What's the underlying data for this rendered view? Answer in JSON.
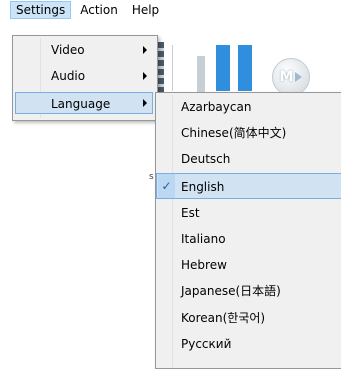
{
  "menubar": {
    "settings": "Settings",
    "action": "Action",
    "help": "Help"
  },
  "toolbar": {
    "m_button": "M"
  },
  "stray_text": "s",
  "settings_menu": {
    "items": [
      {
        "label": "Video",
        "has_submenu": true
      },
      {
        "label": "Audio",
        "has_submenu": true
      },
      {
        "label": "Language",
        "has_submenu": true
      }
    ]
  },
  "language_menu": {
    "items": [
      {
        "label": "Azarbaycan"
      },
      {
        "label": "Chinese(简体中文)"
      },
      {
        "label": "Deutsch"
      },
      {
        "label": "English",
        "checked": true
      },
      {
        "label": "Est"
      },
      {
        "label": "Italiano"
      },
      {
        "label": "Hebrew"
      },
      {
        "label": "Japanese(日本語)"
      },
      {
        "label": "Korean(한국어)"
      },
      {
        "label": "Русский"
      }
    ]
  },
  "colors": {
    "highlight_bg": "#d1e2f2",
    "highlight_border": "#78aee5",
    "menu_bg": "#f0f0f0",
    "pause_blue": "#2f8fde"
  }
}
